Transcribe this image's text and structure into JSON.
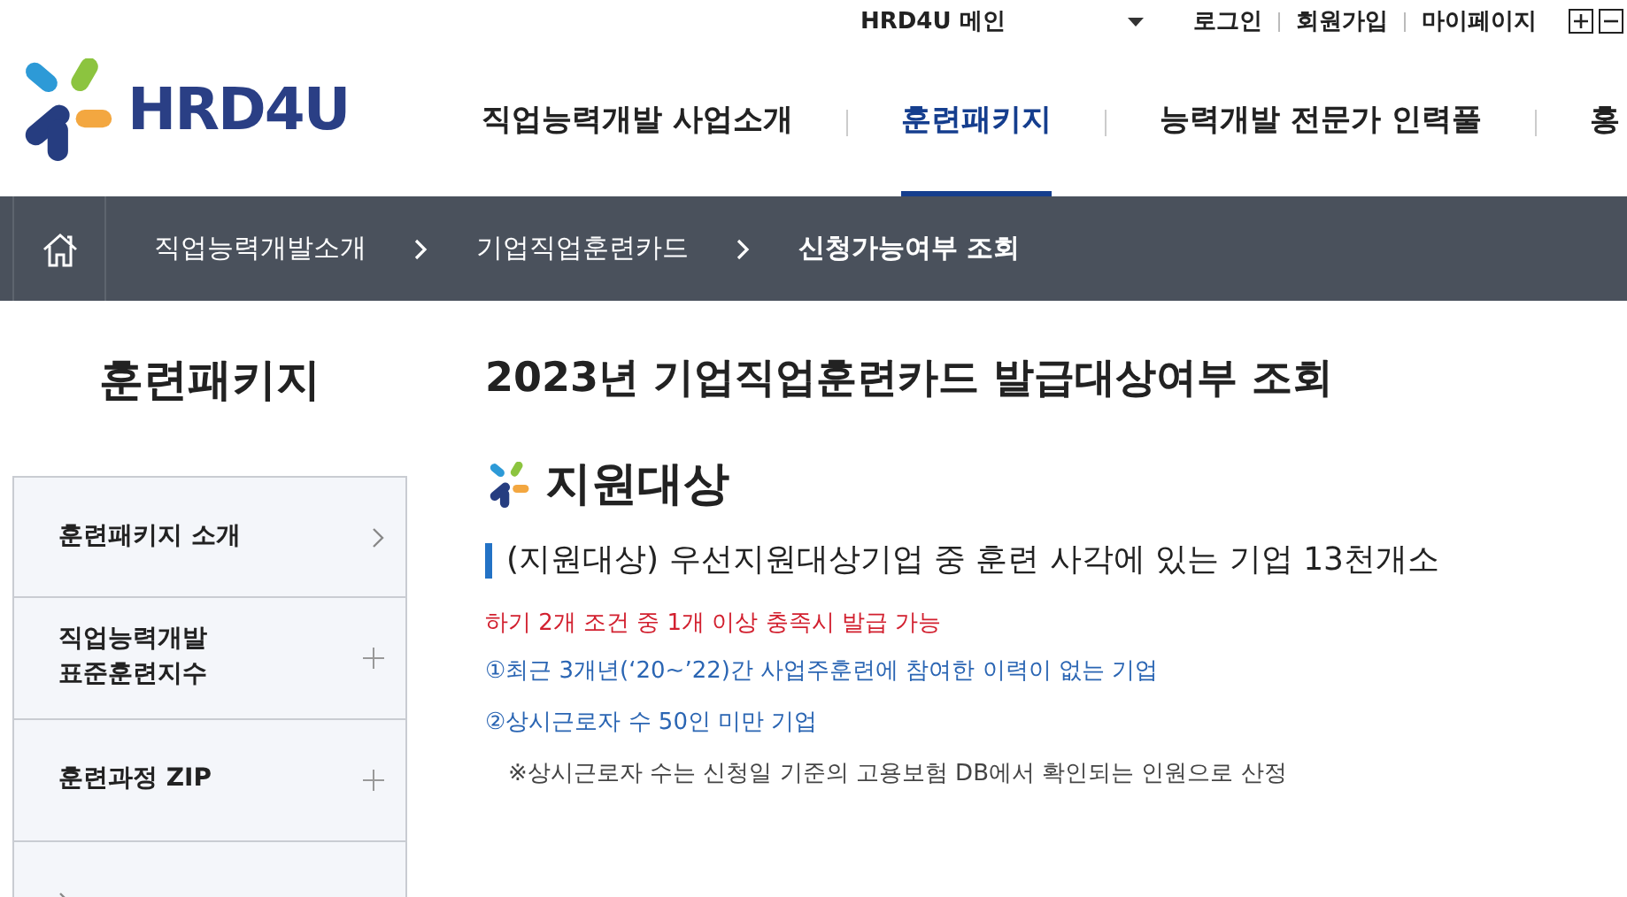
{
  "top_bar": {
    "site_select": "HRD4U 메인",
    "links": [
      "로그인",
      "회원가입",
      "마이페이지"
    ]
  },
  "logo": {
    "text": "HRD4U"
  },
  "nav": [
    {
      "label": "직업능력개발 사업소개",
      "selected": false
    },
    {
      "label": "훈련패키지",
      "selected": true
    },
    {
      "label": "능력개발 전문가 인력풀",
      "selected": false
    },
    {
      "label": "홍",
      "selected": false
    }
  ],
  "breadcrumb": [
    "직업능력개발소개",
    "기업직업훈련카드",
    "신청가능여부 조회"
  ],
  "sidebar": {
    "title": "훈련패키지",
    "items": [
      {
        "label": "훈련패키지 소개",
        "kind": "link"
      },
      {
        "label": "직업능력개발\n표준훈련지수",
        "kind": "expand"
      },
      {
        "label": "훈련과정 ZIP",
        "kind": "expand"
      },
      {
        "kind": "link"
      }
    ]
  },
  "content": {
    "title": "2023년 기업직업훈련카드 발급대상여부 조회",
    "section": "지원대상",
    "subheading": "(지원대상) 우선지원대상기업 중 훈련 사각에 있는 기업 13천개소",
    "lines": [
      {
        "text": "하기 2개 조건 중 1개 이상 충족시 발급 가능",
        "kind": "alert"
      },
      {
        "text": "①최근 3개년(‘20~’22)간 사업주훈련에 참여한 이력이 없는 기업",
        "kind": "condition"
      },
      {
        "text": "②상시근로자 수 50인 미만 기업",
        "kind": "condition"
      },
      {
        "text": "※상시근로자 수는 신청일 기준의 고용보험 DB에서 확인되는 인원으로 산정",
        "kind": "note"
      }
    ]
  }
}
